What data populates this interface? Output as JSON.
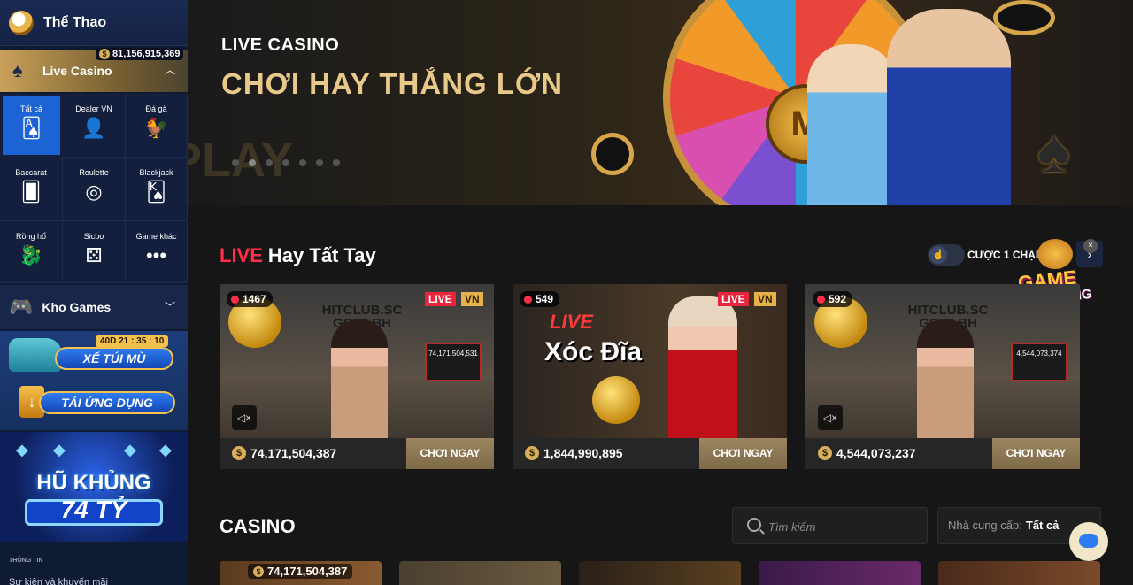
{
  "sidebar": {
    "sports": "Thể Thao",
    "balance": "81,156,915,369",
    "live_casino": "Live Casino",
    "categories": [
      {
        "label": "Tất cả",
        "icon": "cards-icon",
        "active": true
      },
      {
        "label": "Dealer VN",
        "icon": "dealer-icon"
      },
      {
        "label": "Đá gà",
        "icon": "rooster-icon"
      },
      {
        "label": "Baccarat",
        "icon": "baccarat-icon"
      },
      {
        "label": "Roulette",
        "icon": "roulette-icon"
      },
      {
        "label": "Blackjack",
        "icon": "blackjack-icon"
      },
      {
        "label": "Rồng hổ",
        "icon": "dragon-icon"
      },
      {
        "label": "Sicbo",
        "icon": "dice-icon"
      },
      {
        "label": "Game khác",
        "icon": "more-icon"
      }
    ],
    "kho_games": "Kho Games",
    "promo_timer": "40D 21 : 35 : 10",
    "promo_car": "XẾ TÚI MÙ",
    "promo_app": "TẢI ỨNG DỤNG",
    "jackpot_line1": "HŨ KHỦNG",
    "jackpot_line2": "74 TỶ",
    "info_heading": "THÔNG TIN",
    "events_link": "Sự kiện và khuyến mãi"
  },
  "banner": {
    "kicker": "LIVE CASINO",
    "headline": "CHƠI HAY THẮNG LỚN",
    "watermark": "PLAY",
    "slides": 7,
    "active_slide": 1
  },
  "live_section": {
    "title_live": "LIVE",
    "title_rest": "Hay Tất Tay",
    "toggle_label": "CƯỢC 1 CHẠM",
    "promo_line1": "GAME",
    "promo_line2": "XU HƯỚNG",
    "cards": [
      {
        "viewers": "1467",
        "live": "LIVE",
        "lang": "VN",
        "brand": "HITCLUB.SC GO88.BH",
        "amount": "74,171,504,387",
        "play": "CHƠI NGAY",
        "board": "74,171,504,531"
      },
      {
        "viewers": "549",
        "live": "LIVE",
        "lang": "VN",
        "game_live": "LIVE",
        "game_name": "Xóc Đĩa",
        "amount": "1,844,990,895",
        "play": "CHƠI NGAY"
      },
      {
        "viewers": "592",
        "live": "LIVE",
        "lang": "VN",
        "brand": "HITCLUB.SC GO88.BH",
        "amount": "4,544,073,237",
        "play": "CHƠI NGAY",
        "board": "4,544,073,374"
      }
    ]
  },
  "casino_section": {
    "title": "CASINO",
    "search_placeholder": "Tìm kiếm",
    "provider_label": "Nhà cung cấp:",
    "provider_value": "Tất cả",
    "first_tile_amount": "74,171,504,387"
  },
  "colors": {
    "accent_live": "#ff2f4a",
    "gold": "#e8c98a",
    "sidebar_active": "#1e63d4"
  }
}
